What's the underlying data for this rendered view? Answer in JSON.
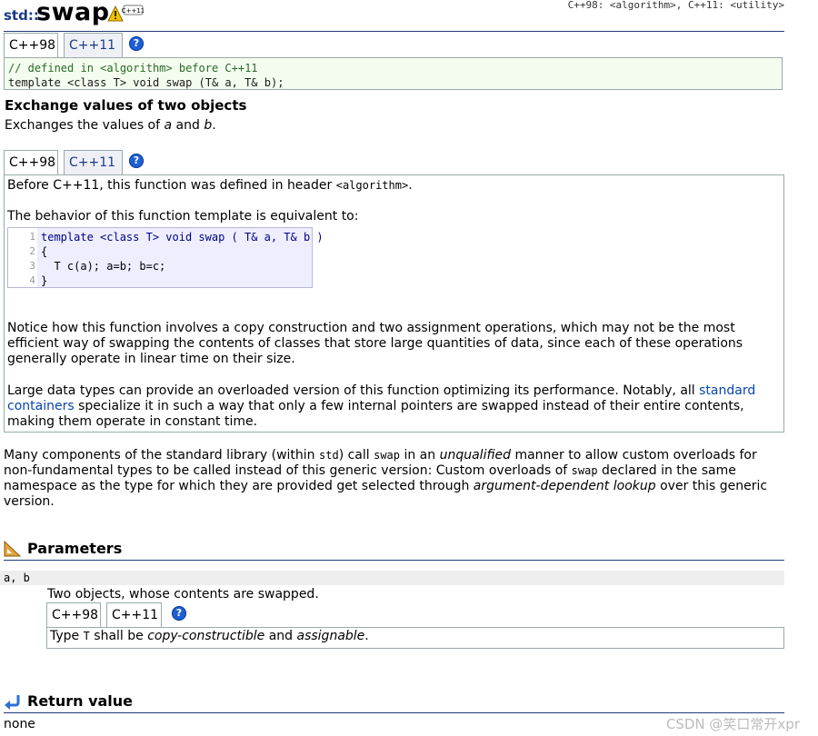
{
  "header": {
    "namespace": "std::",
    "function_name": "swap",
    "headers_note": "C++98: <algorithm>, C++11: <utility>",
    "warn_badge": "C++11"
  },
  "tabs1": {
    "tab_a": "C++98",
    "tab_b": "C++11",
    "help": "?"
  },
  "prototype": {
    "comment": "// defined in <algorithm> before C++11",
    "signature": "template <class T> void swap (T& a, T& b);"
  },
  "summary": {
    "title": "Exchange values of two objects",
    "desc_pre": "Exchanges the values of ",
    "a": "a",
    "and": " and ",
    "b": "b",
    "end": "."
  },
  "tabs2": {
    "tab_a": "C++98",
    "tab_b": "C++11",
    "help": "?"
  },
  "versionbox": {
    "line1_pre": "Before C++11, this function was defined in header ",
    "line1_code": "<algorithm>",
    "line1_end": ".",
    "line2": "The behavior of this function template is equivalent to:",
    "code_lines": [
      "1",
      "2",
      "3",
      "4"
    ],
    "code_1": "template <class T> void swap ( T& a, T& b )",
    "code_2": "{",
    "code_3": "  T c(a); a=b; b=c;",
    "code_4": "}",
    "para1": "Notice how this function involves a copy construction and two assignment operations, which may not be the most efficient way of swapping the contents of classes that store large quantities of data, since each of these operations generally operate in linear time on their size.",
    "para2_pre": "Large data types can provide an overloaded version of this function optimizing its performance. Notably, all ",
    "para2_link": "standard containers",
    "para2_post": " specialize it in such a way that only a few internal pointers are swapped instead of their entire contents, making them operate in constant time."
  },
  "body_para": {
    "p1": "Many components of the standard library (within ",
    "std": "std",
    "p2": ") call ",
    "swap1": "swap",
    "p3": " in an ",
    "unqualified": "unqualified",
    "p4": " manner to allow custom overloads for non-fundamental types to be called instead of this generic version: Custom overloads of ",
    "swap2": "swap",
    "p5": " declared in the same namespace as the type for which they are provided get selected through ",
    "adl": "argument-dependent lookup",
    "p6": " over this generic version."
  },
  "parameters": {
    "title": "Parameters",
    "param_names": "a, b",
    "desc": "Two objects, whose contents are swapped.",
    "tab_a": "C++98",
    "tab_b": "C++11",
    "help": "?",
    "req_pre": "Type ",
    "req_T": "T",
    "req_mid": " shall be ",
    "req_cc": "copy-constructible",
    "req_and": " and ",
    "req_as": "assignable",
    "req_end": "."
  },
  "return_value": {
    "title": "Return value",
    "value": "none"
  },
  "watermark": "CSDN @笑口常开xpr"
}
